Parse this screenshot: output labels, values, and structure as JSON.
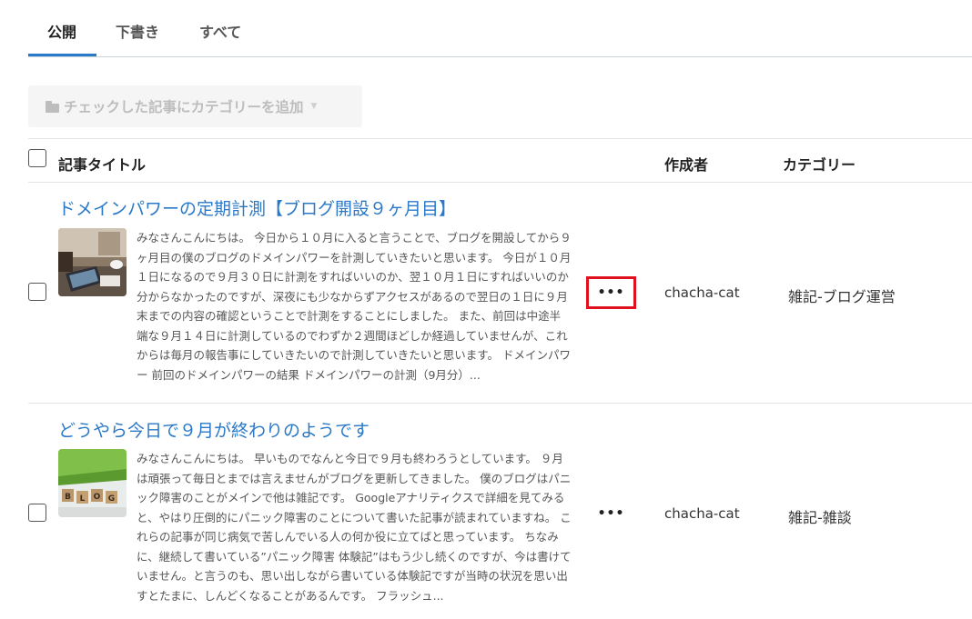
{
  "tabs": [
    {
      "label": "公開",
      "active": true
    },
    {
      "label": "下書き",
      "active": false
    },
    {
      "label": "すべて",
      "active": false
    }
  ],
  "toolbar": {
    "add_category_label": "チェックした記事にカテゴリーを追加"
  },
  "table": {
    "columns": {
      "title": "記事タイトル",
      "author": "作成者",
      "category": "カテゴリー"
    },
    "rows": [
      {
        "title": "ドメインパワーの定期計測【ブログ開設９ヶ月目】",
        "excerpt": "みなさんこんにちは。 今日から１０月に入ると言うことで、ブログを開設してから９ヶ月目の僕のブログのドメインパワーを計測していきたいと思います。 今日が１０月１日になるので９月３０日に計測をすればいいのか、翌１０月１日にすればいいのか分からなかったのですが、深夜にも少なからずアクセスがあるので翌日の１日に９月末までの内容の確認ということで計測をすることにしました。 また、前回は中途半端な９月１４日に計測しているのでわずか２週間ほどしか経過していませんが、これからは毎月の報告事にしていきたいので計測していきたいと思います。 ドメインパワー 前回のドメインパワーの結果 ドメインパワーの計測（9月分）...",
        "more_label": "•••",
        "author": "chacha-cat",
        "category": "雑記-ブログ運営"
      },
      {
        "title": "どうやら今日で９月が終わりのようです",
        "excerpt": "みなさんこんにちは。 早いものでなんと今日で９月も終わろうとしています。 ９月は頑張って毎日とまでは言えませんがブログを更新してきました。 僕のブログはパニック障害のことがメインで他は雑記です。 Googleアナリティクスで詳細を見てみると、やはり圧倒的にパニック障害のことについて書いた記事が読まれていますね。 これらの記事が同じ病気で苦しんでいる人の何か役に立てばと思っています。 ちなみに、継続して書いている”パニック障害 体験記”はもう少し続くのですが、今は書けていません。と言うのも、思い出しながら書いている体験記ですが当時の状況を思い出すとたまに、しんどくなることがあるんです。 フラッシュ...",
        "more_label": "•••",
        "author": "chacha-cat",
        "category": "雑記-雑談"
      }
    ]
  },
  "colors": {
    "accent": "#2a78c8",
    "highlight": "#e0101e"
  }
}
